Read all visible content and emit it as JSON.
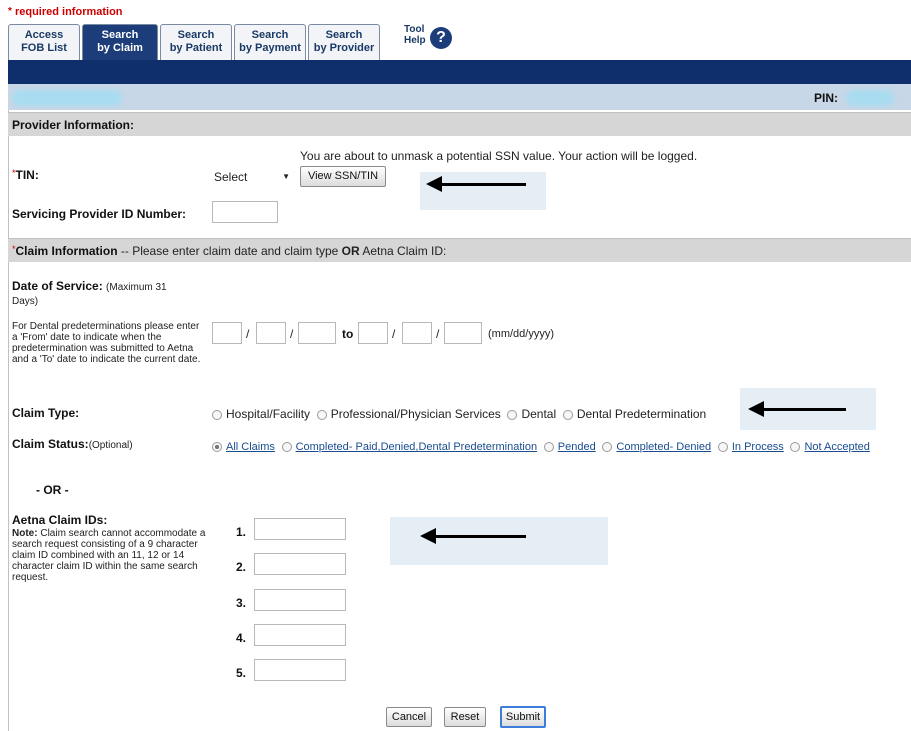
{
  "required_note": "required information",
  "tabs": [
    {
      "line1": "Access",
      "line2": "FOB List"
    },
    {
      "line1": "Search",
      "line2": "by Claim"
    },
    {
      "line1": "Search",
      "line2": "by Patient"
    },
    {
      "line1": "Search",
      "line2": "by Payment"
    },
    {
      "line1": "Search",
      "line2": "by Provider"
    }
  ],
  "tool_help": {
    "line1": "Tool",
    "line2": "Help",
    "icon": "question-icon",
    "glyph": "?"
  },
  "pin_label": "PIN:",
  "provider_section": {
    "title": "Provider Information:",
    "ssn_warning": "You are about to unmask a potential SSN value. Your action will be logged.",
    "tin_label": "TIN:",
    "tin_select": "Select",
    "view_button": "View SSN/TIN",
    "servicing_label": "Servicing Provider ID Number:"
  },
  "claim_section": {
    "title": "Claim Information",
    "instruction_pre": "-- Please enter claim date and claim type",
    "instruction_or": "OR",
    "instruction_post": "Aetna Claim ID:",
    "date_label": "Date of Service:",
    "date_note": "(Maximum 31 Days)",
    "dental_note": "For Dental predeterminations please enter a 'From' date to indicate when the predetermination was submitted to Aetna and a 'To' date to indicate the current date.",
    "to_label": "to",
    "date_format": "(mm/dd/yyyy)",
    "claim_type_label": "Claim Type:",
    "claim_types": [
      "Hospital/Facility",
      "Professional/Physician Services",
      "Dental",
      "Dental Predetermination"
    ],
    "claim_status_label": "Claim Status:",
    "claim_status_optional": "(Optional)",
    "claim_statuses": [
      "All Claims",
      "Completed- Paid,Denied,Dental Predetermination",
      "Pended",
      "Completed- Denied",
      "In Process",
      "Not Accepted"
    ],
    "or_label": "- OR -",
    "aetna_ids_label": "Aetna Claim IDs:",
    "note_bold": "Note:",
    "note_text": "Claim search cannot accommodate a search request consisting of a 9 character claim ID combined with an 11, 12 or 14 character claim ID within the same search request.",
    "id_numbers": [
      "1.",
      "2.",
      "3.",
      "4.",
      "5."
    ]
  },
  "buttons": {
    "cancel": "Cancel",
    "reset": "Reset",
    "submit": "Submit"
  },
  "colors": {
    "nav": "#0e2f6b",
    "active_tab": "#1c3d7a",
    "subbar": "#c7d7e7",
    "section": "#d6d6d6",
    "required": "#cc0000",
    "link": "#1a4d8f"
  }
}
